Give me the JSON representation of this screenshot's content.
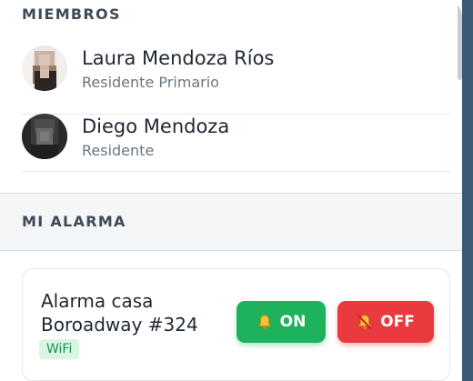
{
  "members_section": {
    "title": "MIEMBROS",
    "members": [
      {
        "name": "Laura Mendoza Ríos",
        "role": "Residente Primario"
      },
      {
        "name": "Diego Mendoza",
        "role": "Residente"
      }
    ]
  },
  "alarm_section": {
    "title": "MI ALARMA",
    "alarm": {
      "name": "Alarma casa Boroadway #324",
      "connection": "WiFi",
      "on_label": "ON",
      "off_label": "OFF",
      "on_icon": "bell-icon",
      "off_icon": "bell-slash-icon"
    }
  },
  "colors": {
    "on_button": "#1fb25d",
    "off_button": "#ea3a3f",
    "badge_bg": "#d8f6e4",
    "badge_text": "#1f8f52",
    "section_title": "#3f4a58"
  }
}
